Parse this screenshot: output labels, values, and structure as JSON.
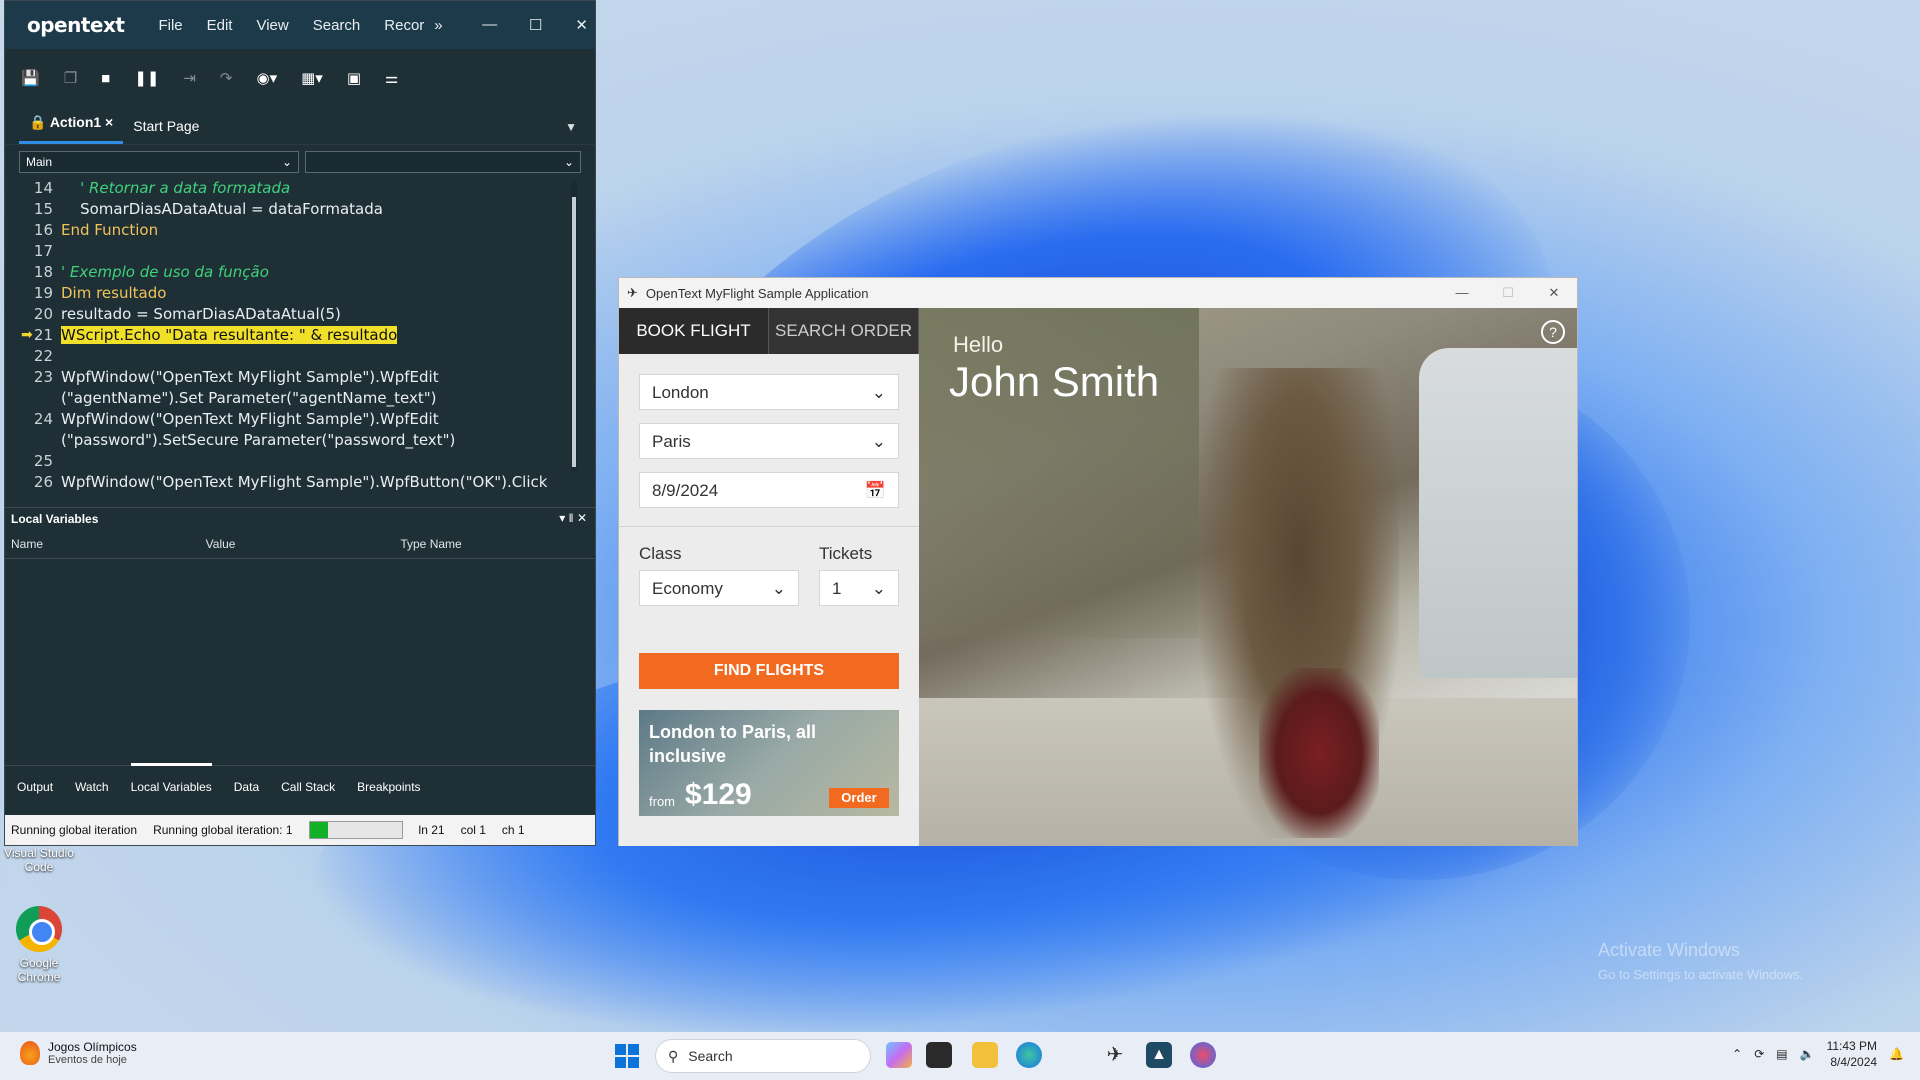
{
  "desktop": {
    "icons": [
      {
        "label": "Visual Studio Code"
      },
      {
        "label": "Google Chrome"
      }
    ],
    "watermark_title": "Activate Windows",
    "watermark_sub": "Go to Settings to activate Windows."
  },
  "uft": {
    "logo": "opentext",
    "menu": [
      "File",
      "Edit",
      "View",
      "Search",
      "Recor"
    ],
    "menu_overflow": "»",
    "tabs": [
      {
        "label": "Action1",
        "close": "×"
      },
      {
        "label": "Start Page"
      }
    ],
    "combo_main": "Main",
    "combo_second": "",
    "code": {
      "current_line": 21,
      "lines": [
        {
          "n": "14",
          "text": "    ' Retornar a data formatada"
        },
        {
          "n": "15",
          "text": "    SomarDiasADataAtual = dataFormatada"
        },
        {
          "n": "16",
          "text": "End Function"
        },
        {
          "n": "17",
          "text": ""
        },
        {
          "n": "18",
          "text": "' Exemplo de uso da função"
        },
        {
          "n": "19",
          "text": "Dim resultado"
        },
        {
          "n": "20",
          "text": "resultado = SomarDiasADataAtual(5)"
        },
        {
          "n": "21",
          "text": "WScript.Echo \"Data resultante: \" & resultado"
        },
        {
          "n": "22",
          "text": ""
        },
        {
          "n": "23",
          "text": "WpfWindow(\"OpenText MyFlight Sample\").WpfEdit"
        },
        {
          "n": "",
          "text": "(\"agentName\").Set Parameter(\"agentName_text\")"
        },
        {
          "n": "24",
          "text": "WpfWindow(\"OpenText MyFlight Sample\").WpfEdit"
        },
        {
          "n": "",
          "text": "(\"password\").SetSecure Parameter(\"password_text\")"
        },
        {
          "n": "25",
          "text": ""
        },
        {
          "n": "26",
          "text": "WpfWindow(\"OpenText MyFlight Sample\").WpfButton(\"OK\").Click"
        }
      ]
    },
    "local_vars_title": "Local Variables",
    "local_vars_columns": [
      "Name",
      "Value",
      "Type Name"
    ],
    "bottom_tabs": [
      "Output",
      "Watch",
      "Local Variables",
      "Data",
      "Call Stack",
      "Breakpoints"
    ],
    "active_bottom_tab": "Local Variables",
    "status": {
      "left": "Running global iteration",
      "iter": "Running global iteration: 1",
      "progress": 0.2,
      "ln": "ln 21",
      "col": "col 1",
      "ch": "ch 1"
    }
  },
  "flight": {
    "title": "OpenText MyFlight Sample Application",
    "tabs": [
      "BOOK FLIGHT",
      "SEARCH ORDER"
    ],
    "from": "London",
    "to": "Paris",
    "date": "8/9/2024",
    "class_label": "Class",
    "class_value": "Economy",
    "tickets_label": "Tickets",
    "tickets_value": "1",
    "find_button": "FIND FLIGHTS",
    "promo": {
      "title": "London to Paris, all inclusive",
      "from": "from",
      "price": "$129",
      "order": "Order"
    },
    "hello": "Hello",
    "user": "John Smith",
    "help": "?"
  },
  "taskbar": {
    "news_title": "Jogos Olímpicos",
    "news_sub": "Eventos de hoje",
    "search_placeholder": "Search",
    "time": "11:43 PM",
    "date": "8/4/2024"
  }
}
